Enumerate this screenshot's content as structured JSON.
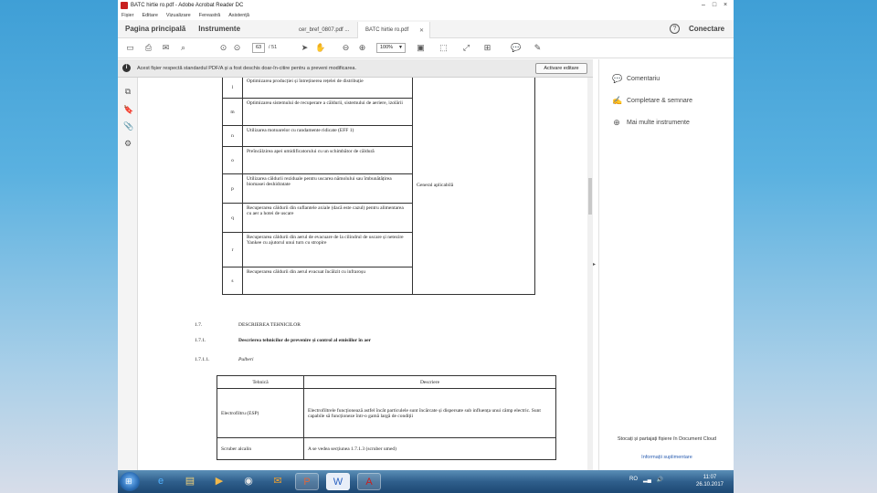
{
  "window": {
    "title": "BATC hirtie ro.pdf - Adobe Acrobat Reader DC",
    "controls": [
      "–",
      "□",
      "×"
    ]
  },
  "menu": [
    "Fișier",
    "Editare",
    "Vizualizare",
    "Fereastră",
    "Asistență"
  ],
  "tabs": {
    "home": "Pagina principală",
    "tools": "Instrumente",
    "docs": [
      {
        "label": "cer_bref_0807.pdf ...",
        "active": false
      },
      {
        "label": "BATC hirtie ro.pdf",
        "active": true
      }
    ],
    "sign_in": "Conectare"
  },
  "toolbar": {
    "current_page": "63",
    "page_total": "/ 51",
    "zoom": "100%"
  },
  "notification": {
    "message": "Acest fișier respectă standardul PDF/A și a fost deschis doar-în-citire pentru a preveni modificarea.",
    "button": "Activare editare"
  },
  "document": {
    "table1": {
      "rows": [
        {
          "letter": "l",
          "text": "Optimizarea producției și întreținerea rețelei de distribuție"
        },
        {
          "letter": "m",
          "text": "Optimizarea sistemului de recuperare a căldurii, sistemului de aeriere, izolării"
        },
        {
          "letter": "n",
          "text": "Utilizarea motoarelor cu randamente ridicate (EFF 1)"
        },
        {
          "letter": "o",
          "text": "Preîncălzirea apei umidificatorului cu un schimbător de căldură"
        },
        {
          "letter": "p",
          "text": "Utilizarea căldurii reziduale pentru uscarea nămolului sau îmbunătățirea biomasei deshidratate"
        },
        {
          "letter": "q",
          "text": "Recuperarea căldurii din suflantele axiale (dacă este cazul) pentru alimentarea cu aer a hotei de uscare"
        },
        {
          "letter": "r",
          "text": "Recuperarea căldurii din aerul de evacuare de la cilindrul de uscare și netezire Yankee cu ajutorul unui turn cu stropire"
        },
        {
          "letter": "s",
          "text": "Recuperarea căldurii din aerul evacuat încălzit cu infraroșu"
        }
      ],
      "applicability": "General aplicabilă"
    },
    "headings": [
      {
        "num": "1.7.",
        "text": "DESCRIEREA TEHNICILOR",
        "bold": false
      },
      {
        "num": "1.7.1.",
        "text": "Descrierea tehnicilor de prevenire și control al emisiilor în aer",
        "bold": true
      },
      {
        "num": "1.7.1.1.",
        "text": "Pulberi",
        "bold": false
      }
    ],
    "table2": {
      "headers": [
        "Tehnică",
        "Descriere"
      ],
      "rows": [
        {
          "technique": "Electrofiltru (ESP)",
          "description": "Electrofiltrele funcționează astfel încât particulele sunt încărcate și dispersate sub influența unui câmp electric. Sunt capabile să funcționeze într-o gamă largă de condiții"
        },
        {
          "technique": "Scruber alcalin",
          "description": "A se vedea secțiunea 1.7.1.3 (scruber umed)"
        }
      ]
    }
  },
  "right_panel": {
    "items": [
      {
        "label": "Comentariu",
        "icon": "comment-icon",
        "color": "#e8b400"
      },
      {
        "label": "Completare & semnare",
        "icon": "pen-sign-icon",
        "color": "#7b50c9"
      },
      {
        "label": "Mai multe instrumente",
        "icon": "more-tools-icon",
        "color": "#555555"
      }
    ],
    "cloud_text": "Stocați și partajați fișiere în Document Cloud",
    "cloud_link": "Informații suplimentare"
  },
  "taskbar": {
    "apps": [
      "start-button",
      "ie-icon",
      "explorer-icon",
      "media-icon",
      "chrome-icon",
      "outlook-icon",
      "powerpoint-icon",
      "word-icon",
      "acrobat-icon"
    ],
    "tray_lang": "RO",
    "time": "11:07",
    "date": "26.10.2017"
  },
  "colors": {
    "acrobat_red": "#c8201f",
    "desktop_top": "#3f9fd6",
    "taskbar": "#2f5f8c"
  }
}
